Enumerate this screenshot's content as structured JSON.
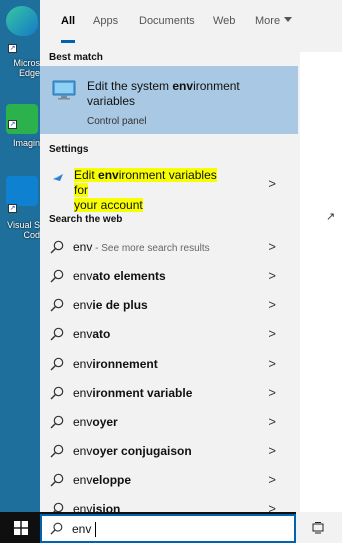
{
  "desktop": {
    "icons": [
      {
        "label": "Micros",
        "label2": "Edge"
      },
      {
        "label": "QQ",
        "label2": "Imagin"
      },
      {
        "label": "Visual S",
        "label2": "Cod"
      }
    ]
  },
  "tabs": [
    {
      "label": "All"
    },
    {
      "label": "Apps"
    },
    {
      "label": "Documents"
    },
    {
      "label": "Web"
    },
    {
      "label": "More"
    }
  ],
  "best_match": {
    "heading": "Best match",
    "title_pre": "Edit the system ",
    "title_bold": "env",
    "title_post": "ironment variables",
    "subtitle": "Control panel"
  },
  "settings": {
    "heading": "Settings",
    "line1_pre": "Edit ",
    "line1_bold": "env",
    "line1_post": "ironment variables for",
    "line2": "your account"
  },
  "web": {
    "heading": "Search the web",
    "items": [
      {
        "pre": "env",
        "bold": "",
        "hint": " - See more search results"
      },
      {
        "pre": "env",
        "bold": "ato elements",
        "hint": ""
      },
      {
        "pre": "env",
        "bold": "ie de plus",
        "hint": ""
      },
      {
        "pre": "env",
        "bold": "ato",
        "hint": ""
      },
      {
        "pre": "env",
        "bold": "ironnement",
        "hint": ""
      },
      {
        "pre": "env",
        "bold": "ironment variable",
        "hint": ""
      },
      {
        "pre": "env",
        "bold": "oyer",
        "hint": ""
      },
      {
        "pre": "env",
        "bold": "oyer conjugaison",
        "hint": ""
      },
      {
        "pre": "env",
        "bold": "eloppe",
        "hint": ""
      },
      {
        "pre": "env",
        "bold": "ision",
        "hint": ""
      }
    ]
  },
  "search": {
    "value": "env"
  },
  "chevron": ">",
  "colors": {
    "accent": "#0063b1",
    "best_match_bg": "#a9c8e4",
    "highlight": "#f7ff00",
    "panel_bg": "#f2f2f2",
    "taskbar": "#0f0f10"
  }
}
